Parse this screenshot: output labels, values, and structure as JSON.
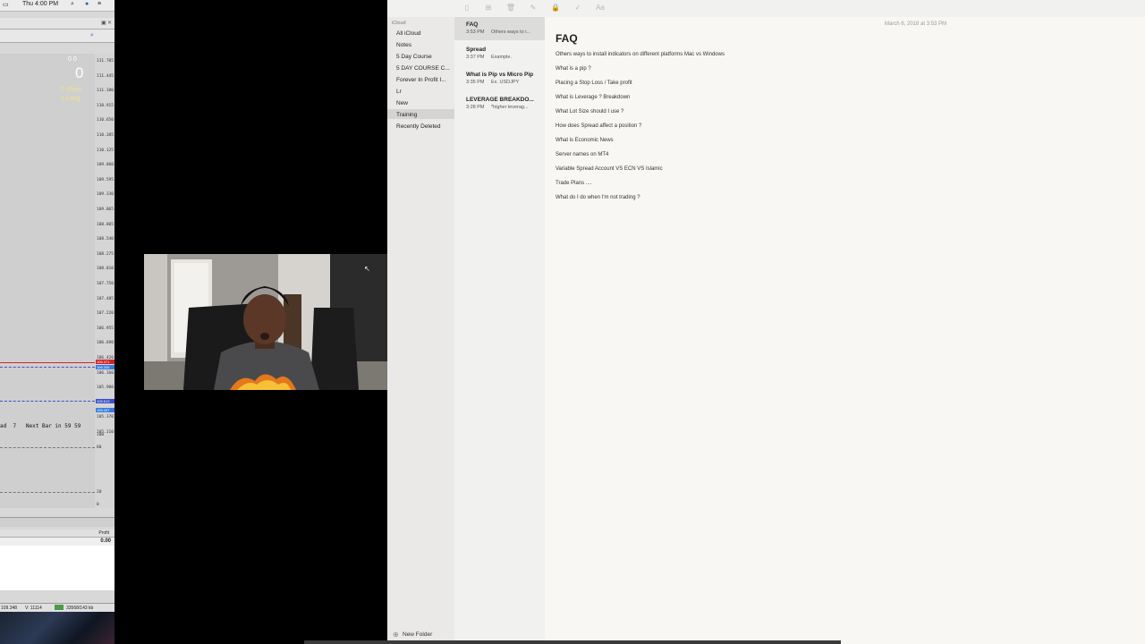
{
  "menubar": {
    "time": "Thu 4:00 PM"
  },
  "terminal": {
    "balance_top": "0   0",
    "balance_big": "0",
    "short_label": "0  Short",
    "long_label": "0  Long",
    "axis_ticks": [
      "111.705",
      "111.445",
      "111.180",
      "110.915",
      "110.650",
      "110.385",
      "110.125",
      "109.860",
      "109.595",
      "109.330",
      "109.065",
      "108.805",
      "108.540",
      "108.275",
      "108.010",
      "107.750",
      "107.485",
      "107.220",
      "106.955",
      "106.690",
      "106.420",
      "106.160",
      "105.900",
      "105.635",
      "105.370",
      "105.110"
    ],
    "level_red": "106.371",
    "level_blue": "106.335",
    "level_blue2": "105.613",
    "level_blue3": "105.497",
    "indicator_ticks": [
      "100",
      "80",
      "20",
      "0"
    ],
    "next_bar_text": "ad  7   Next Bar in 59 59",
    "profit_header": "Profit",
    "profit_value": "0.00",
    "status_price": "109.348",
    "status_volume": "V: 11114",
    "status_traffic": "33568/143 kb"
  },
  "notes": {
    "toolbar": [
      "sidebar-toggle",
      "grid-view",
      "delete",
      "compose",
      "lock",
      "checklist",
      "format"
    ],
    "sidebar": {
      "account": "iCloud",
      "folders": [
        "All iCloud",
        "Notes",
        "5 Day Course",
        "5 DAY COURSE C...",
        "Forever In Profit I...",
        "Lr",
        "New",
        "Training",
        "Recently Deleted"
      ],
      "selected_index": 7,
      "new_folder": "New Folder"
    },
    "list": [
      {
        "title": "FAQ",
        "time": "3:53 PM",
        "snippet": "Others ways to i..."
      },
      {
        "title": "Spread",
        "time": "3:37 PM",
        "snippet": "Example."
      },
      {
        "title": "What is Pip vs Micro Pip",
        "time": "3:35 PM",
        "snippet": "Ex. USDJPY"
      },
      {
        "title": "LEVERAGE BREAKDO...",
        "time": "3:28 PM",
        "snippet": "*higher leverag..."
      }
    ],
    "note": {
      "date": "March 6, 2018 at 3:53 PM",
      "title": "FAQ",
      "lines": [
        "Others ways to install indicators on different platforms Mac vs Windows",
        "What is a pip ?",
        "Placing a Stop Loss / Take profit",
        "What is Leverage ? Breakdown",
        "What Lot Size should I use ?",
        "How does Spread affect a position ?",
        "What is Economic News",
        "Server names on MT4",
        "Variable Spread Account VS ECN VS Islamic",
        "Trade Plans ....",
        "What do I do when I'm not trading ?"
      ]
    }
  }
}
